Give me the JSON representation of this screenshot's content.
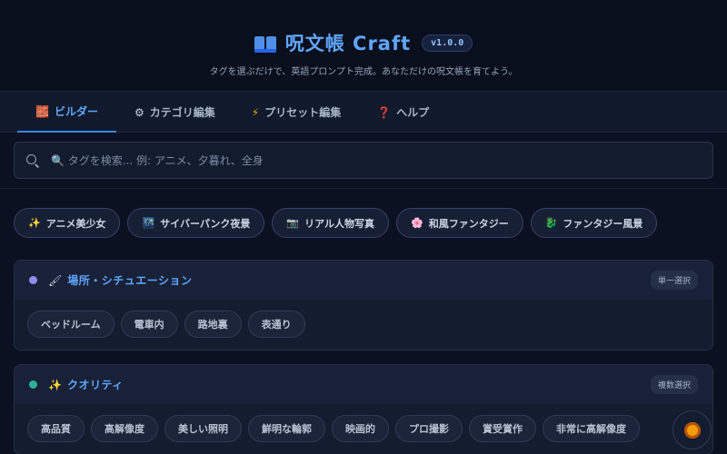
{
  "header": {
    "icon": "open-book-icon",
    "title": "呪文帳 Craft",
    "version": "v1.0.0",
    "subtitle": "タグを選ぶだけで、英語プロンプト完成。あなただけの呪文帳を育てよう。"
  },
  "tabs": [
    {
      "label": "ビルダー",
      "icon": "builder-icon",
      "glyph": "🧱",
      "active": true
    },
    {
      "label": "カテゴリ編集",
      "icon": "gear-icon",
      "glyph": "⚙",
      "active": false
    },
    {
      "label": "プリセット編集",
      "icon": "lightning-icon",
      "glyph": "⚡",
      "active": false
    },
    {
      "label": "ヘルプ",
      "icon": "question-icon",
      "glyph": "❓",
      "active": false
    }
  ],
  "search": {
    "placeholder": "🔍 タグを検索... 例: アニメ、夕暮れ、全身",
    "value": ""
  },
  "presets": [
    {
      "label": "アニメ美少女",
      "icon": "sparkles-icon",
      "glyph": "✨"
    },
    {
      "label": "サイバーパンク夜景",
      "icon": "city-night-icon",
      "glyph": "🌃"
    },
    {
      "label": "リアル人物写真",
      "icon": "camera-icon",
      "glyph": "📷"
    },
    {
      "label": "和風ファンタジー",
      "icon": "cherry-blossom-icon",
      "glyph": "🌸"
    },
    {
      "label": "ファンタジー風景",
      "icon": "dragon-icon",
      "glyph": "🐉"
    }
  ],
  "categories": [
    {
      "title": "場所・シチュエーション",
      "icon": "brush-icon",
      "glyph": "🖌",
      "dot_color": "#8b8ff0",
      "mode": "単一選択",
      "tags": [
        "ベッドルーム",
        "電車内",
        "路地裏",
        "表通り"
      ]
    },
    {
      "title": "クオリティ",
      "icon": "sparkles-icon",
      "glyph": "✨",
      "dot_color": "#2bb39a",
      "mode": "複数選択",
      "tags": [
        "高品質",
        "高解像度",
        "美しい照明",
        "鮮明な輪郭",
        "映画的",
        "プロ撮影",
        "賞受賞作",
        "非常に高解像度"
      ]
    }
  ],
  "fab": {
    "icon": "flower-icon"
  }
}
